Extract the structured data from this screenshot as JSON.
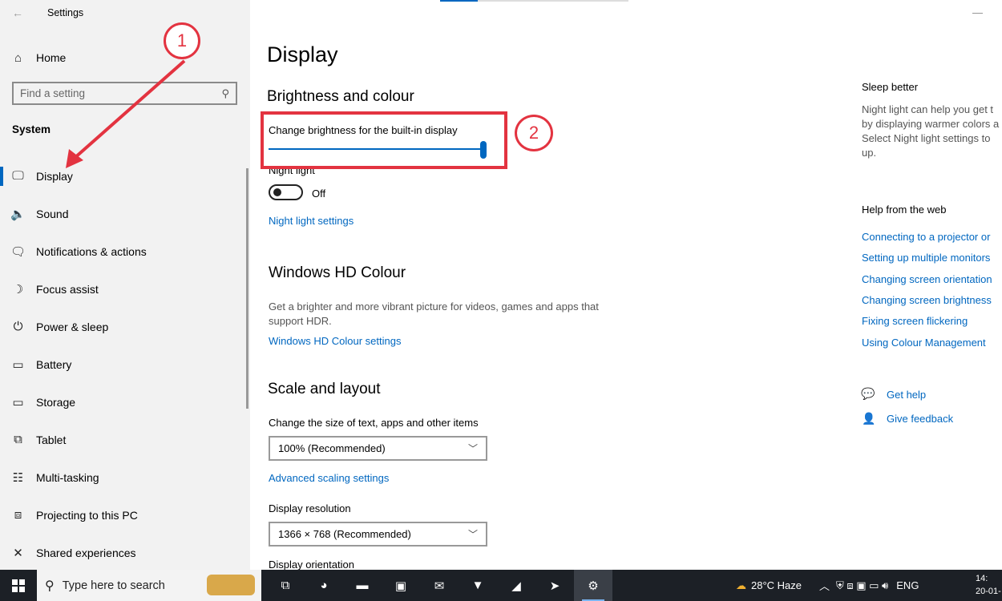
{
  "window": {
    "title": "Settings",
    "minimize_glyph": "—"
  },
  "sidebar": {
    "home_label": "Home",
    "search_placeholder": "Find a setting",
    "section": "System",
    "items": [
      {
        "label": "Display",
        "icon": "monitor-icon",
        "glyph": "🖵",
        "active": true
      },
      {
        "label": "Sound",
        "icon": "speaker-icon",
        "glyph": "🔈"
      },
      {
        "label": "Notifications & actions",
        "icon": "notification-icon",
        "glyph": "🗨"
      },
      {
        "label": "Focus assist",
        "icon": "moon-icon",
        "glyph": "☽"
      },
      {
        "label": "Power & sleep",
        "icon": "power-icon",
        "glyph": "⏻"
      },
      {
        "label": "Battery",
        "icon": "battery-icon",
        "glyph": "▭"
      },
      {
        "label": "Storage",
        "icon": "storage-icon",
        "glyph": "▭"
      },
      {
        "label": "Tablet",
        "icon": "tablet-icon",
        "glyph": "⧉"
      },
      {
        "label": "Multi-tasking",
        "icon": "multitasking-icon",
        "glyph": "☷"
      },
      {
        "label": "Projecting to this PC",
        "icon": "projecting-icon",
        "glyph": "⧈"
      },
      {
        "label": "Shared experiences",
        "icon": "shared-icon",
        "glyph": "✕"
      }
    ]
  },
  "main": {
    "title": "Display",
    "brightness": {
      "heading": "Brightness and colour",
      "slider_label": "Change brightness for the built-in display",
      "slider_value_percent": 100,
      "night_light_label": "Night light",
      "night_light_state": "Off",
      "night_light_link": "Night light settings"
    },
    "hd_colour": {
      "heading": "Windows HD Colour",
      "desc_line1": "Get a brighter and more vibrant picture for videos, games and apps that",
      "desc_line2": "support HDR.",
      "link": "Windows HD Colour settings"
    },
    "scale": {
      "heading": "Scale and layout",
      "size_label": "Change the size of text, apps and other items",
      "size_value": "100% (Recommended)",
      "advanced_link": "Advanced scaling settings",
      "resolution_label": "Display resolution",
      "resolution_value": "1366 × 768 (Recommended)",
      "orientation_label": "Display orientation"
    }
  },
  "right_panel": {
    "sleep_title": "Sleep better",
    "sleep_desc": [
      "Night light can help you get t",
      "by displaying warmer colors a",
      "Select Night light settings to",
      "up."
    ],
    "help_title": "Help from the web",
    "help_links": [
      "Connecting to a projector or",
      "Setting up multiple monitors",
      "Changing screen orientation",
      "Changing screen brightness",
      "Fixing screen flickering",
      "Using Colour Management"
    ],
    "get_help": "Get help",
    "give_feedback": "Give feedback"
  },
  "annotations": {
    "step1": "1",
    "step2": "2",
    "color": "#e33340"
  },
  "taskbar": {
    "search_text": "Type here to search",
    "apps": [
      {
        "name": "task-view-icon",
        "glyph": "⧉"
      },
      {
        "name": "edge-icon",
        "glyph": "◕"
      },
      {
        "name": "file-explorer-icon",
        "glyph": "▬"
      },
      {
        "name": "store-icon",
        "glyph": "▣"
      },
      {
        "name": "mail-icon",
        "glyph": "✉"
      },
      {
        "name": "brave-icon",
        "glyph": "▼"
      },
      {
        "name": "app-icon",
        "glyph": "◢"
      },
      {
        "name": "telegram-icon",
        "glyph": "➤"
      },
      {
        "name": "settings-gear-icon",
        "glyph": "⚙",
        "active": true
      }
    ],
    "weather": "28°C  Haze",
    "language": "ENG",
    "time": "14:",
    "date": "20-01-"
  }
}
